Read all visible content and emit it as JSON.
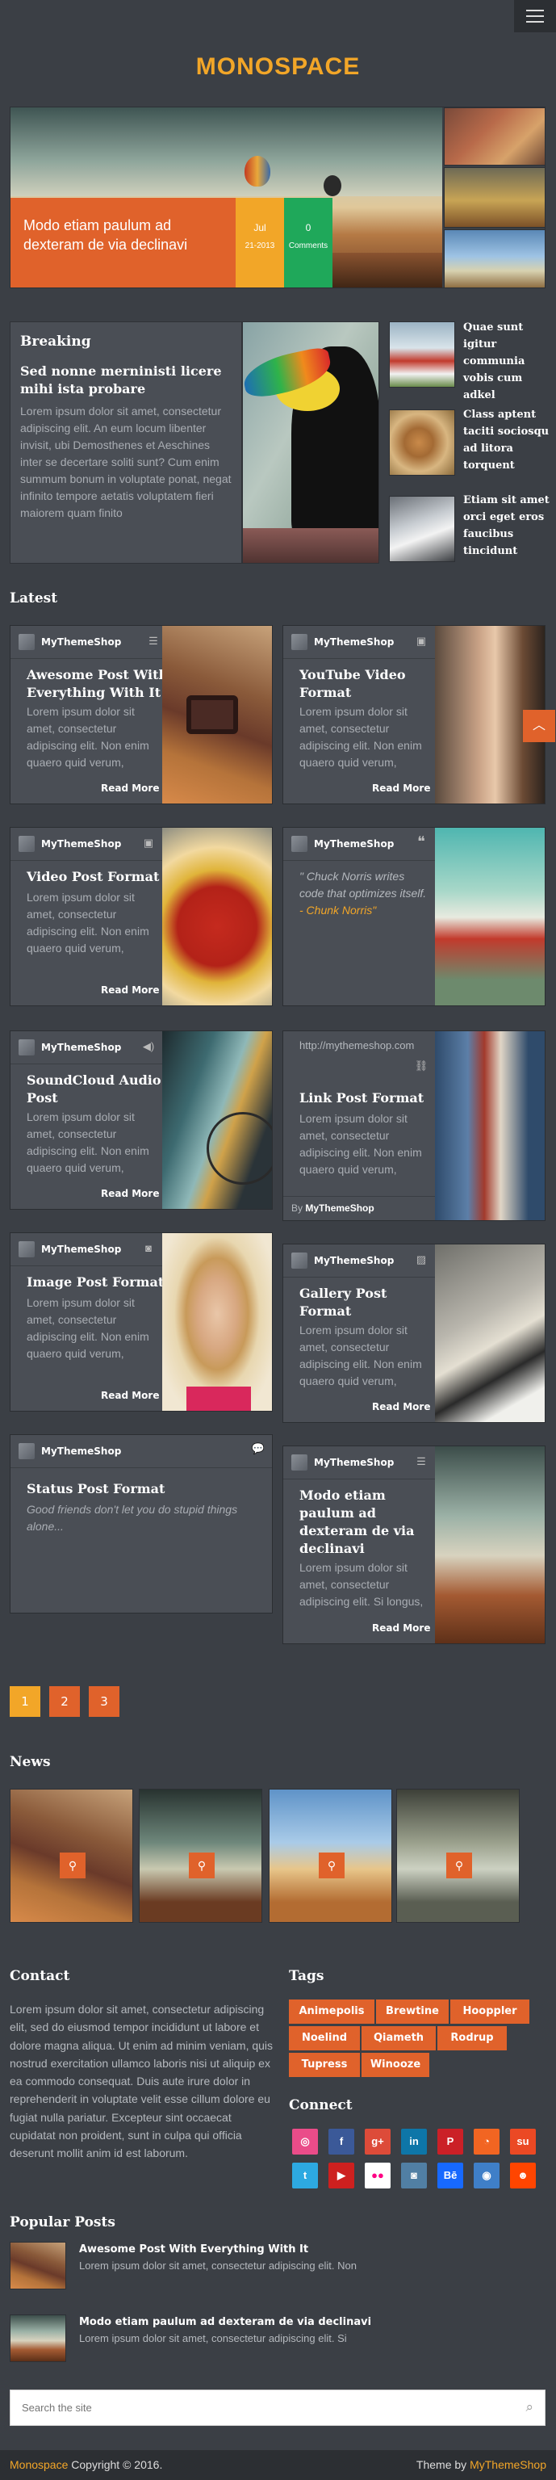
{
  "header": {
    "logo": "MONOSPACE"
  },
  "slider": {
    "caption": "Modo etiam paulum ad dexteram de via declinavi",
    "date_line1": "Jul",
    "date_line2": "21-2013",
    "comments_count": "0",
    "comments_label": "Comments"
  },
  "breaking": {
    "heading": "Breaking",
    "title": "Sed nonne merninisti licere mihi ista probare",
    "excerpt": "Lorem ipsum dolor sit amet, consectetur adipiscing elit. An eum locum libenter invisit, ubi Demosthenes et Aeschines inter se decertare soliti sunt? Cum enim summum bonum in voluptate ponat, negat infinito tempore aetatis voluptatem fieri maiorem quam finito",
    "side": [
      {
        "title": "Quae sunt igitur communia vobis cum adkel"
      },
      {
        "title": "Class aptent taciti sociosqu ad litora torquent"
      },
      {
        "title": "Etiam sit amet orci eget eros faucibus tincidunt"
      }
    ]
  },
  "latest": {
    "heading": "Latest",
    "author": "MyThemeShop",
    "read_more": "Read More",
    "excerpt": "Lorem ipsum dolor sit amet, consectetur adipiscing elit. Non enim quaero quid verum,",
    "cards": [
      {
        "title": "Awesome Post With Everything With It"
      },
      {
        "title": "YouTube Video Format"
      },
      {
        "title": "Video Post Format"
      },
      {
        "quote": "\" Chuck Norris writes code that optimizes itself.",
        "quote_author": "- Chunk Norris\""
      },
      {
        "title": "SoundCloud Audio Post"
      },
      {
        "link_url": "http://mythemeshop.com",
        "title": "Link Post Format",
        "by": "By",
        "by_name": "MyThemeShop"
      },
      {
        "title": "Image Post Format"
      },
      {
        "title": "Gallery Post Format"
      },
      {
        "title": "Status Post Format",
        "status_text": "Good friends don't let you do stupid things alone..."
      },
      {
        "title": "Modo etiam paulum ad dexteram de via declinavi",
        "excerpt": "Lorem ipsum dolor sit amet, consectetur adipiscing elit. Si longus,"
      }
    ]
  },
  "pagination": [
    "1",
    "2",
    "3"
  ],
  "news": {
    "heading": "News"
  },
  "contact": {
    "heading": "Contact",
    "text": "Lorem ipsum dolor sit amet, consectetur adipiscing elit, sed do eiusmod tempor incididunt ut labore et dolore magna aliqua. Ut enim ad minim veniam, quis nostrud exercitation ullamco laboris nisi ut aliquip ex ea commodo consequat. Duis aute irure dolor in reprehenderit in voluptate velit esse cillum dolore eu fugiat nulla pariatur. Excepteur sint occaecat cupidatat non proident, sunt in culpa qui officia deserunt mollit anim id est laborum."
  },
  "tags": {
    "heading": "Tags",
    "items": [
      "Animepolis",
      "Brewtine",
      "Hooppler",
      "Noelind",
      "Qiameth",
      "Rodrup",
      "Tupress",
      "Winooze"
    ]
  },
  "connect": {
    "heading": "Connect",
    "icons": [
      {
        "name": "dribbble-icon",
        "glyph": "◎",
        "color": "#ea4c89"
      },
      {
        "name": "facebook-icon",
        "glyph": "f",
        "color": "#3b5998"
      },
      {
        "name": "googleplus-icon",
        "glyph": "g+",
        "color": "#dd4b39"
      },
      {
        "name": "linkedin-icon",
        "glyph": "in",
        "color": "#0e76a8"
      },
      {
        "name": "pinterest-icon",
        "glyph": "P",
        "color": "#cb2027"
      },
      {
        "name": "rss-icon",
        "glyph": "◔",
        "color": "#f26522"
      },
      {
        "name": "stumbleupon-icon",
        "glyph": "su",
        "color": "#eb4924"
      },
      {
        "name": "twitter-icon",
        "glyph": "t",
        "color": "#2da9e1"
      },
      {
        "name": "youtube-icon",
        "glyph": "▶",
        "color": "#cd201f"
      },
      {
        "name": "flickr-icon",
        "glyph": "●●",
        "color": "#ffffff"
      },
      {
        "name": "instagram-icon",
        "glyph": "◙",
        "color": "#517fa4"
      },
      {
        "name": "behance-icon",
        "glyph": "Bē",
        "color": "#1769ff"
      },
      {
        "name": "github-icon",
        "glyph": "◉",
        "color": "#3f7fc8"
      },
      {
        "name": "reddit-icon",
        "glyph": "☻",
        "color": "#ff4500"
      }
    ]
  },
  "popular": {
    "heading": "Popular Posts",
    "items": [
      {
        "title": "Awesome Post With Everything With It",
        "excerpt": "Lorem ipsum dolor sit amet, consectetur adipiscing elit. Non"
      },
      {
        "title": "Modo etiam paulum ad dexteram de via declinavi",
        "excerpt": "Lorem ipsum dolor sit amet, consectetur adipiscing elit. Si"
      }
    ]
  },
  "search": {
    "placeholder": "Search the site"
  },
  "footer": {
    "brand": "Monospace",
    "copyright": "Copyright © 2016.",
    "theme_by": "Theme by",
    "theme_author": "MyThemeShop"
  },
  "colors": {
    "accent": "#e0622b",
    "logo": "#f2a628",
    "green": "#1fa85a",
    "background": "#3b3f45"
  }
}
